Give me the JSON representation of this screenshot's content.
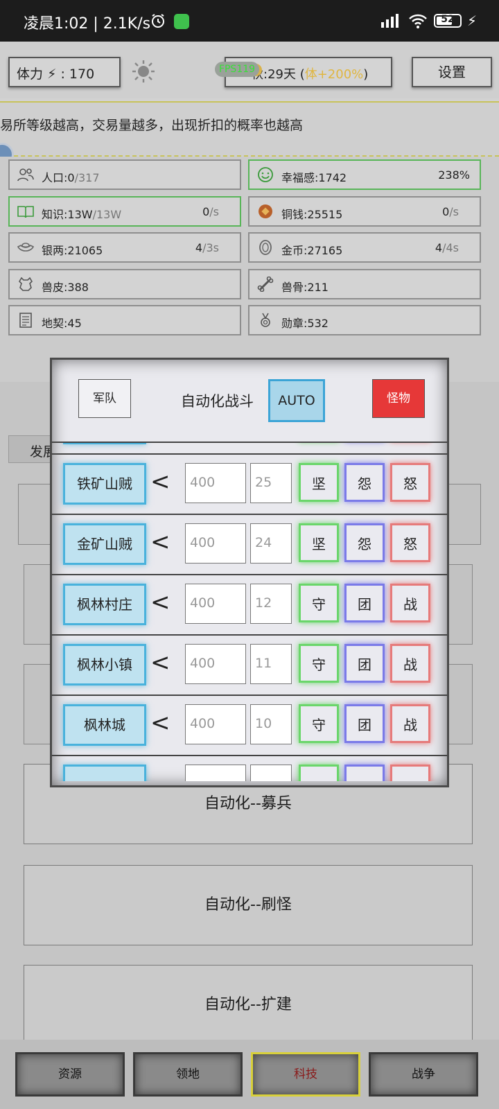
{
  "status_bar": {
    "time_speed": "凌晨1:02 | 2.1K/s",
    "battery": "52"
  },
  "top": {
    "stamina_label": "体力",
    "stamina_value": "170",
    "fps": "FPS119",
    "season_text": "秋:29天 (",
    "season_bonus": "体+200%",
    "season_close": ")",
    "settings": "设置"
  },
  "tip": "易所等级越高，交易量越多，出现折扣的概率也越高",
  "resources": [
    {
      "icon": "people-icon",
      "label": "人口:0",
      "dim": "/317",
      "rate": "",
      "rate_dim": ""
    },
    {
      "icon": "smile-icon",
      "label": "幸福感:1742",
      "dim": "",
      "rate": "238%",
      "rate_dim": ""
    },
    {
      "icon": "book-icon",
      "label": "知识:13W",
      "dim": "/13W",
      "rate": "0",
      "rate_dim": "/s"
    },
    {
      "icon": "copper-coin-icon",
      "label": "铜钱:25515",
      "dim": "",
      "rate": "0",
      "rate_dim": "/s"
    },
    {
      "icon": "silver-ingot-icon",
      "label": "银两:21065",
      "dim": "",
      "rate": "4",
      "rate_dim": "/3s"
    },
    {
      "icon": "gold-coin-icon",
      "label": "金币:27165",
      "dim": "",
      "rate": "4",
      "rate_dim": "/4s"
    },
    {
      "icon": "hide-icon",
      "label": "兽皮:388",
      "dim": "",
      "rate": "",
      "rate_dim": ""
    },
    {
      "icon": "bone-icon",
      "label": "兽骨:211",
      "dim": "",
      "rate": "",
      "rate_dim": ""
    },
    {
      "icon": "contract-icon",
      "label": "地契:45",
      "dim": "",
      "rate": "",
      "rate_dim": ""
    },
    {
      "icon": "medal-icon",
      "label": "勋章:532",
      "dim": "",
      "rate": "",
      "rate_dim": ""
    }
  ],
  "dev_tab": "发展",
  "big_buttons": [
    "自动化--募兵",
    "自动化--刷怪",
    "自动化--扩建"
  ],
  "modal": {
    "army": "军队",
    "title": "自动化战斗",
    "auto": "AUTO",
    "monster": "怪物",
    "rows": [
      {
        "name": "铁矿山贼",
        "lt": "<",
        "v1": "400",
        "v2": "25",
        "t1": "坚",
        "t2": "怨",
        "t3": "怒"
      },
      {
        "name": "金矿山贼",
        "lt": "<",
        "v1": "400",
        "v2": "24",
        "t1": "坚",
        "t2": "怨",
        "t3": "怒"
      },
      {
        "name": "枫林村庄",
        "lt": "<",
        "v1": "400",
        "v2": "12",
        "t1": "守",
        "t2": "团",
        "t3": "战"
      },
      {
        "name": "枫林小镇",
        "lt": "<",
        "v1": "400",
        "v2": "11",
        "t1": "守",
        "t2": "团",
        "t3": "战"
      },
      {
        "name": "枫林城",
        "lt": "<",
        "v1": "400",
        "v2": "10",
        "t1": "守",
        "t2": "团",
        "t3": "战"
      }
    ]
  },
  "nav": [
    "资源",
    "领地",
    "科技",
    "战争"
  ]
}
